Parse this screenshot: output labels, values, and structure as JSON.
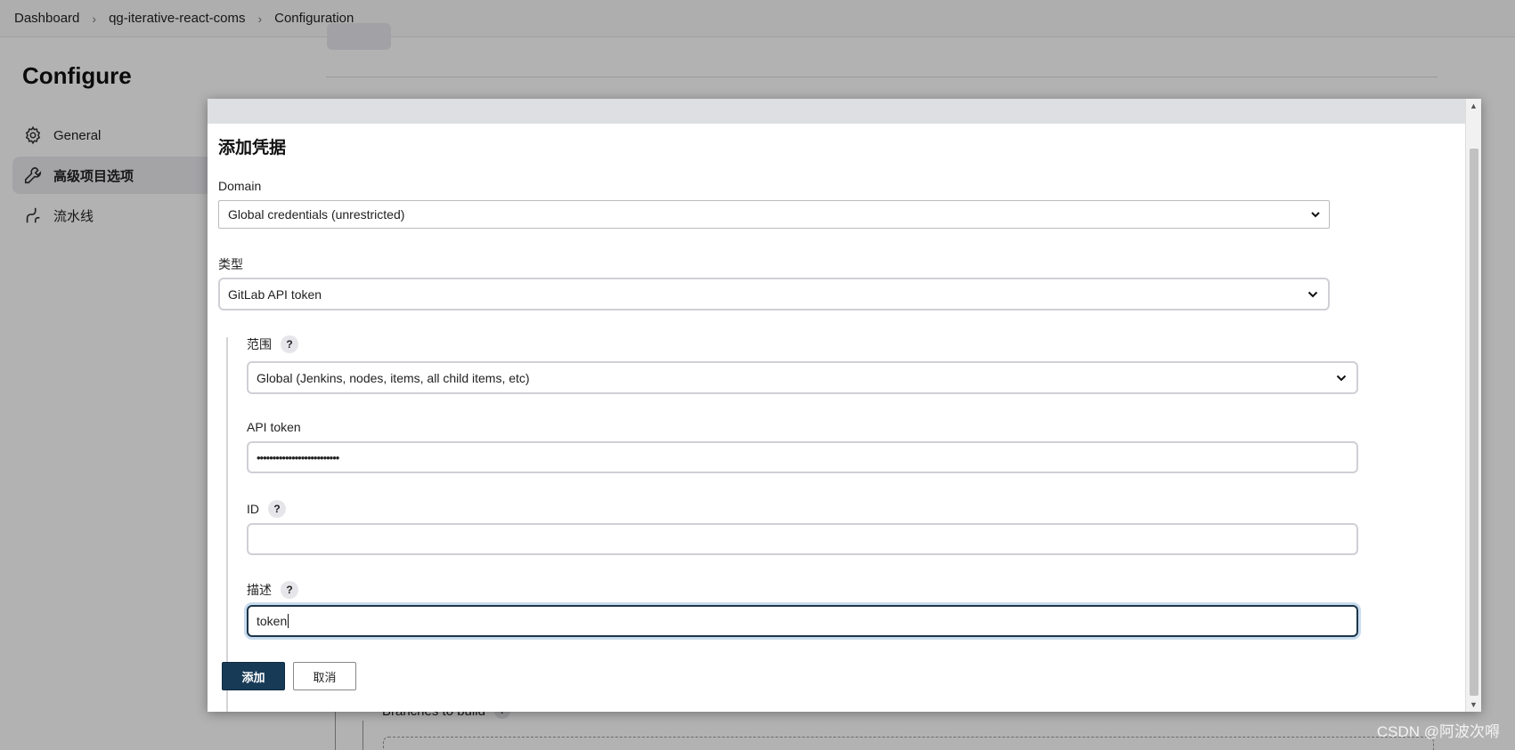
{
  "breadcrumb": [
    "Dashboard",
    "qg-iterative-react-coms",
    "Configuration"
  ],
  "page": {
    "title": "Configure"
  },
  "sidebar": {
    "items": [
      {
        "label": "General",
        "icon": "gear-icon"
      },
      {
        "label": "高级项目选项",
        "icon": "wrench-icon"
      },
      {
        "label": "流水线",
        "icon": "pipeline-icon"
      }
    ]
  },
  "background": {
    "branches_label": "Branches to build",
    "help": "?"
  },
  "dialog": {
    "title": "添加凭据",
    "domain": {
      "label": "Domain",
      "value": "Global credentials (unrestricted)"
    },
    "kind": {
      "label": "类型",
      "value": "GitLab API token"
    },
    "scope": {
      "label": "范围",
      "value": "Global (Jenkins, nodes, items, all child items, etc)",
      "help": "?"
    },
    "api_token": {
      "label": "API token",
      "value": "••••••••••••••••••••••••••"
    },
    "id": {
      "label": "ID",
      "value": "",
      "help": "?"
    },
    "description": {
      "label": "描述",
      "value": "token",
      "help": "?"
    },
    "add_button": "添加",
    "cancel_button": "取消"
  },
  "watermark": "CSDN @阿波次嘚"
}
